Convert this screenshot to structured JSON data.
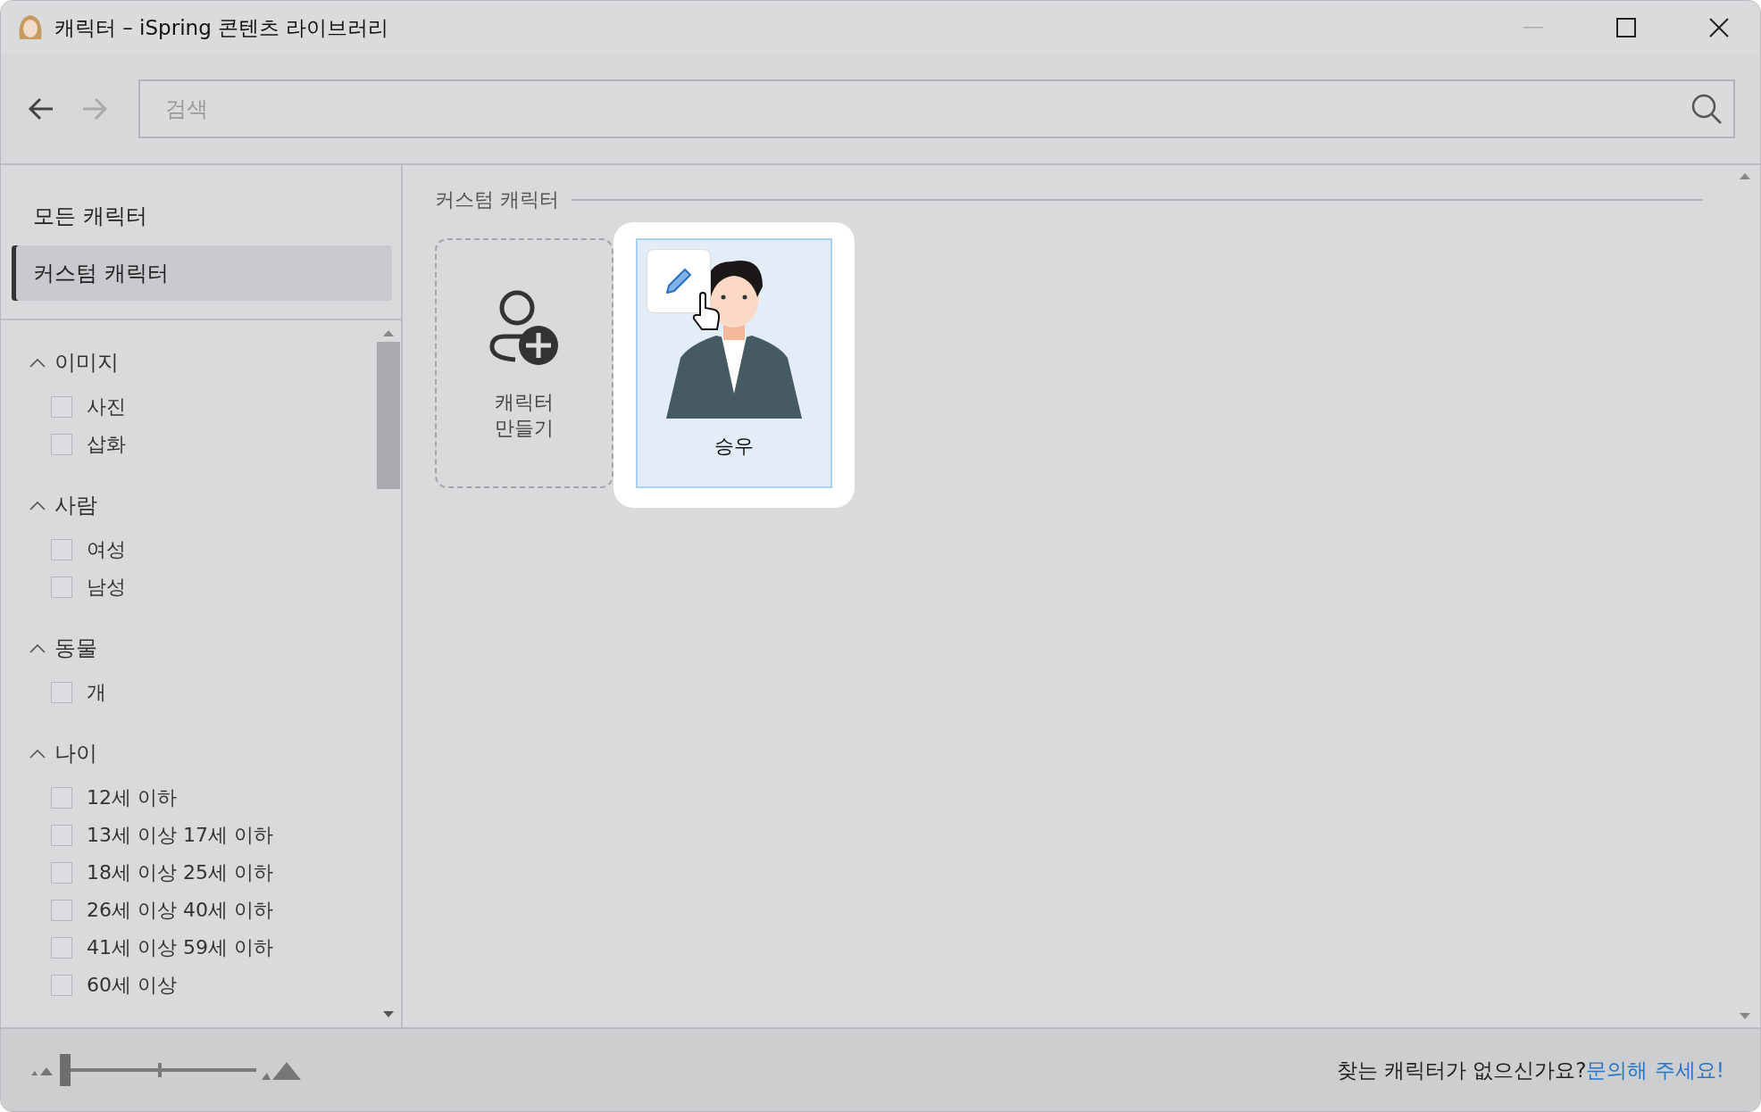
{
  "window": {
    "title": "캐릭터 – iSpring 콘텐츠 라이브러리"
  },
  "search": {
    "placeholder": "검색"
  },
  "nav": {
    "back_disabled": false,
    "forward_disabled": true
  },
  "sidebar": {
    "items": [
      {
        "label": "모든 캐릭터",
        "selected": false
      },
      {
        "label": "커스텀 캐릭터",
        "selected": true
      }
    ],
    "filters": [
      {
        "title": "이미지",
        "expanded": true,
        "options": [
          {
            "label": "사진",
            "checked": false
          },
          {
            "label": "삽화",
            "checked": false
          }
        ]
      },
      {
        "title": "사람",
        "expanded": true,
        "options": [
          {
            "label": "여성",
            "checked": false
          },
          {
            "label": "남성",
            "checked": false
          }
        ]
      },
      {
        "title": "동물",
        "expanded": true,
        "options": [
          {
            "label": "개",
            "checked": false
          }
        ]
      },
      {
        "title": "나이",
        "expanded": true,
        "options": [
          {
            "label": "12세 이하",
            "checked": false
          },
          {
            "label": "13세 이상 17세 이하",
            "checked": false
          },
          {
            "label": "18세 이상 25세 이하",
            "checked": false
          },
          {
            "label": "26세 이상 40세 이하",
            "checked": false
          },
          {
            "label": "41세 이상 59세 이하",
            "checked": false
          },
          {
            "label": "60세 이상",
            "checked": false
          }
        ]
      }
    ]
  },
  "section": {
    "title": "커스텀 캐릭터",
    "cards": [
      {
        "kind": "create",
        "label": "캐릭터\n만들기",
        "selected": false
      },
      {
        "kind": "character",
        "label": "승우",
        "selected": true
      }
    ]
  },
  "footer": {
    "size_slider": {
      "level": 0
    },
    "prompt": "찾는 캐릭터가 없으신가요?",
    "link": "문의해 주세요!"
  }
}
